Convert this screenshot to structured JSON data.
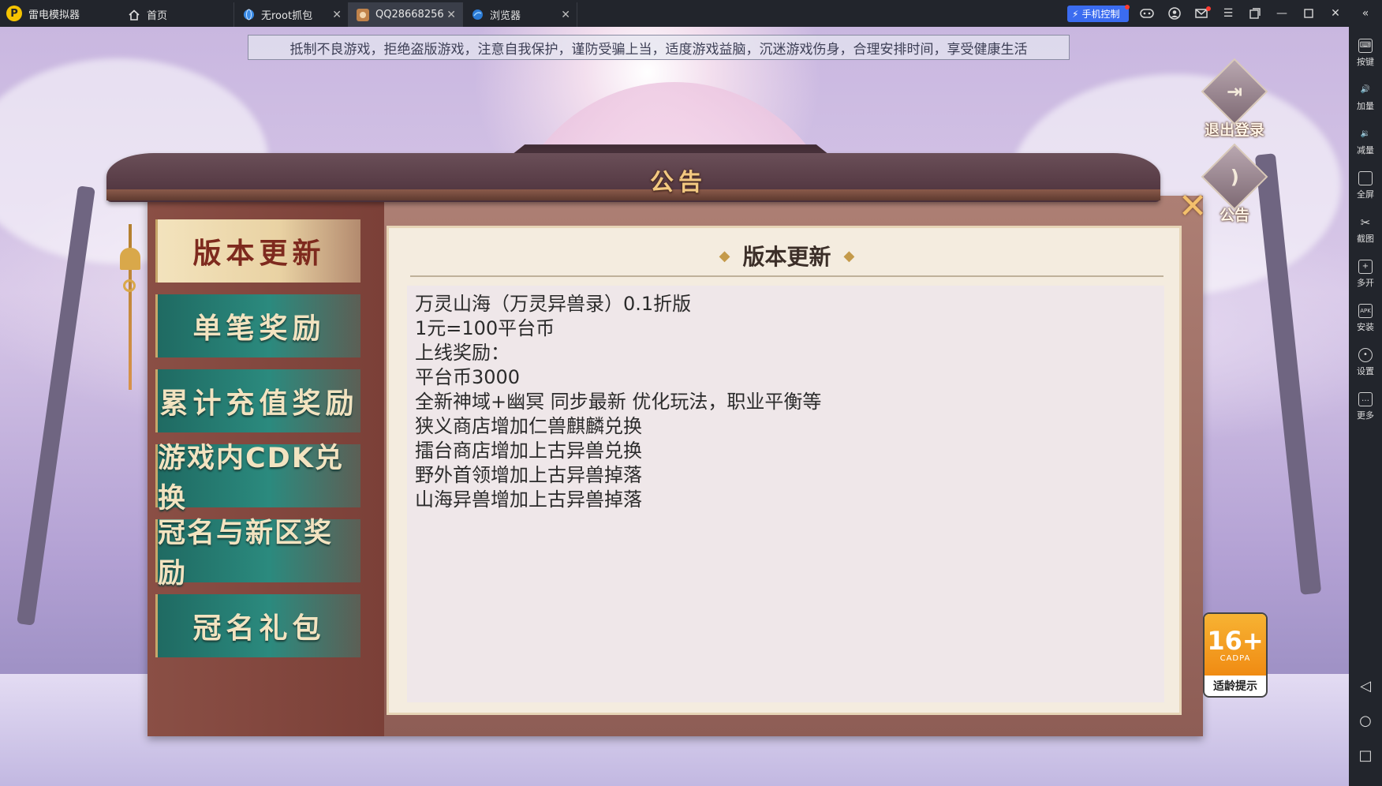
{
  "window": {
    "app_title": "雷电模拟器",
    "tabs": [
      {
        "label": "首页",
        "active": false,
        "closable": false,
        "icon": "home-icon"
      },
      {
        "label": "无root抓包",
        "active": false,
        "closable": true,
        "icon": "globe-icon"
      },
      {
        "label": "QQ28668256",
        "active": true,
        "closable": true,
        "icon": "game-icon"
      },
      {
        "label": "浏览器",
        "active": false,
        "closable": true,
        "icon": "browser-icon"
      }
    ],
    "phone_control_label": "手机控制",
    "accent_color": "#3b6cf0"
  },
  "sidebar": {
    "items": [
      {
        "label": "按键",
        "icon": "keyboard-icon"
      },
      {
        "label": "加量",
        "icon": "volume-up-icon"
      },
      {
        "label": "减量",
        "icon": "volume-down-icon"
      },
      {
        "label": "全屏",
        "icon": "fullscreen-icon"
      },
      {
        "label": "截图",
        "icon": "scissors-icon"
      },
      {
        "label": "多开",
        "icon": "multi-instance-icon"
      },
      {
        "label": "安装",
        "icon": "apk-icon"
      },
      {
        "label": "设置",
        "icon": "gear-icon"
      },
      {
        "label": "更多",
        "icon": "more-icon"
      }
    ],
    "nav": {
      "back": "back-icon",
      "home": "home-circle-icon",
      "recents": "recents-icon"
    }
  },
  "game": {
    "health_notice": "抵制不良游戏，拒绝盗版游戏，注意自我保护，谨防受骗上当，适度游戏益脑，沉迷游戏伤身，合理安排时间，享受健康生活",
    "logout_label": "退出登录",
    "announcement_label": "公告",
    "dialog": {
      "title": "公告",
      "menu": [
        {
          "label": "版本更新",
          "active": true
        },
        {
          "label": "单笔奖励",
          "active": false
        },
        {
          "label": "累计充值奖励",
          "active": false
        },
        {
          "label": "游戏内CDK兑换",
          "active": false
        },
        {
          "label": "冠名与新区奖励",
          "active": false
        },
        {
          "label": "冠名礼包",
          "active": false
        }
      ],
      "content_title": "版本更新",
      "content_lines": [
        "万灵山海（万灵异兽录）0.1折版",
        "1元=100平台币",
        "上线奖励：",
        "平台币3000",
        "全新神域+幽冥 同步最新 优化玩法，职业平衡等",
        "狭义商店增加仁兽麒麟兑换",
        "擂台商店增加上古异兽兑换",
        "野外首领增加上古异兽掉落",
        "山海异兽增加上古异兽掉落"
      ]
    },
    "age_rating": {
      "number": "16+",
      "org": "CADPA",
      "tip": "适龄提示"
    }
  }
}
